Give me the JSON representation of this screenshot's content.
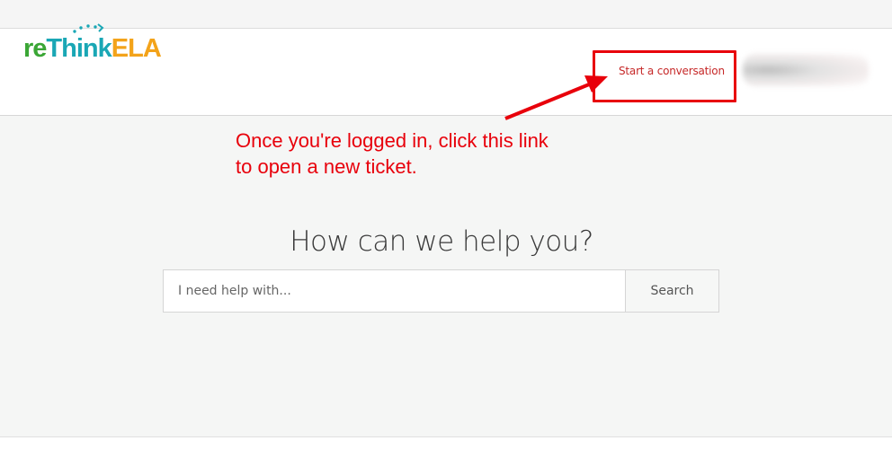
{
  "header": {
    "logo": {
      "part1": "re",
      "part2": "Think",
      "part3": "ELA"
    },
    "start_conversation_label": "Start a conversation"
  },
  "annotation": {
    "line1": "Once you're logged in, click this link",
    "line2": "to open a new ticket."
  },
  "hero": {
    "title": "How can we help you?"
  },
  "search": {
    "placeholder": "I need help with...",
    "button_label": "Search"
  },
  "colors": {
    "annotation_red": "#e8000b",
    "link_red": "#c62828",
    "logo_green": "#3aa635",
    "logo_teal": "#1aa7b5",
    "logo_orange": "#f3a31a"
  }
}
